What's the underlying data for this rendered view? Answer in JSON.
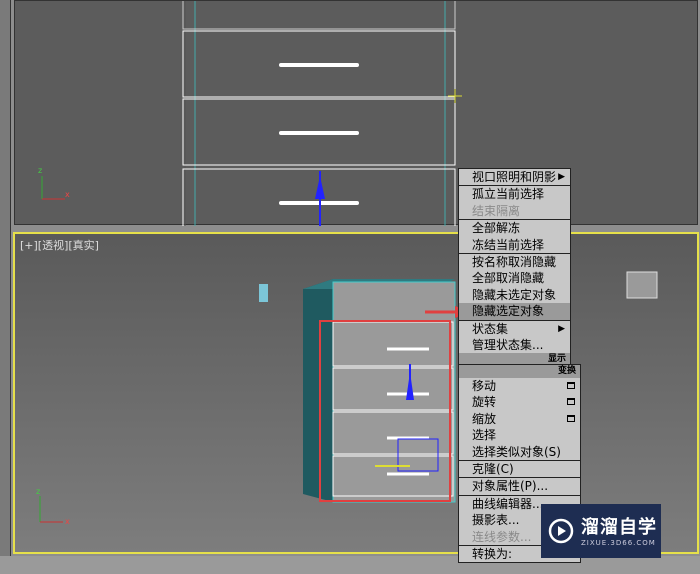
{
  "viewports": {
    "perspective_label": "[+][透视][真实]"
  },
  "menu_display": {
    "items": [
      {
        "label": "视口照明和阴影",
        "submenu": true
      },
      {
        "label": "孤立当前选择"
      },
      {
        "label": "结束隔离",
        "disabled": true
      },
      {
        "label": "全部解冻"
      },
      {
        "label": "冻结当前选择"
      },
      {
        "label": "按名称取消隐藏"
      },
      {
        "label": "全部取消隐藏"
      },
      {
        "label": "隐藏未选定对象"
      },
      {
        "label": "隐藏选定对象",
        "highlighted": true
      },
      {
        "label": "状态集",
        "submenu": true
      },
      {
        "label": "管理状态集..."
      }
    ],
    "header": "显示"
  },
  "menu_transform": {
    "header": "变换",
    "items": [
      {
        "label": "移动"
      },
      {
        "label": "旋转"
      },
      {
        "label": "缩放"
      },
      {
        "label": "选择"
      },
      {
        "label": "选择类似对象(S)"
      },
      {
        "label": "克隆(C)"
      },
      {
        "label": "对象属性(P)..."
      },
      {
        "label": "曲线编辑器..."
      },
      {
        "label": "摄影表..."
      },
      {
        "label": "连线参数...",
        "disabled": true
      },
      {
        "label": "转换为:"
      }
    ]
  },
  "watermark": {
    "title": "溜溜自学",
    "url": "ZIXUE.3D66.COM"
  },
  "colors": {
    "selection": "#e6e04a",
    "highlight_box": "#e04040",
    "accent": "#1e2d52"
  }
}
